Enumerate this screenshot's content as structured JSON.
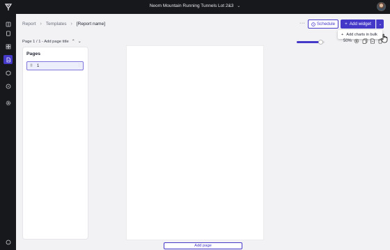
{
  "app": {
    "project_title": "Neom Mountain Running Tunnels Lot 2&3",
    "title_chevron_icon": "chevron-down-icon",
    "logo_icon": "brand-logo-icon",
    "avatar_icon": "user-avatar"
  },
  "rail": {
    "items": [
      {
        "icon": "book-icon"
      },
      {
        "icon": "clipboard-icon"
      },
      {
        "icon": "grid-icon"
      },
      {
        "icon": "report-icon",
        "active": true
      },
      {
        "icon": "cube-icon"
      },
      {
        "icon": "compass-icon"
      },
      {
        "icon": "settings-icon"
      },
      {
        "icon": "help-icon"
      }
    ],
    "accent_color": "#4438c9"
  },
  "breadcrumb": {
    "items": [
      "Report",
      "Templates",
      "[Report name]"
    ]
  },
  "toolbar": {
    "more_label": "···",
    "schedule_label": "Schedule",
    "add_widget_label": "Add widget",
    "add_widget_plus": "+",
    "caret": "⌄"
  },
  "dropdown": {
    "items": [
      {
        "icon": "plus-icon",
        "plus": "+",
        "label": "Add charts in bulk"
      }
    ]
  },
  "page_info": {
    "label": "Page 1 / 1 - Add page title",
    "up": "⌃",
    "down": "⌄"
  },
  "zoom": {
    "level_label": "50%",
    "slider_fraction": 0.85
  },
  "pages": {
    "title": "Pages",
    "items": [
      {
        "number": "1",
        "grip": "⠿",
        "menu": "⋮"
      }
    ]
  },
  "footer": {
    "add_page_label": "Add page"
  }
}
